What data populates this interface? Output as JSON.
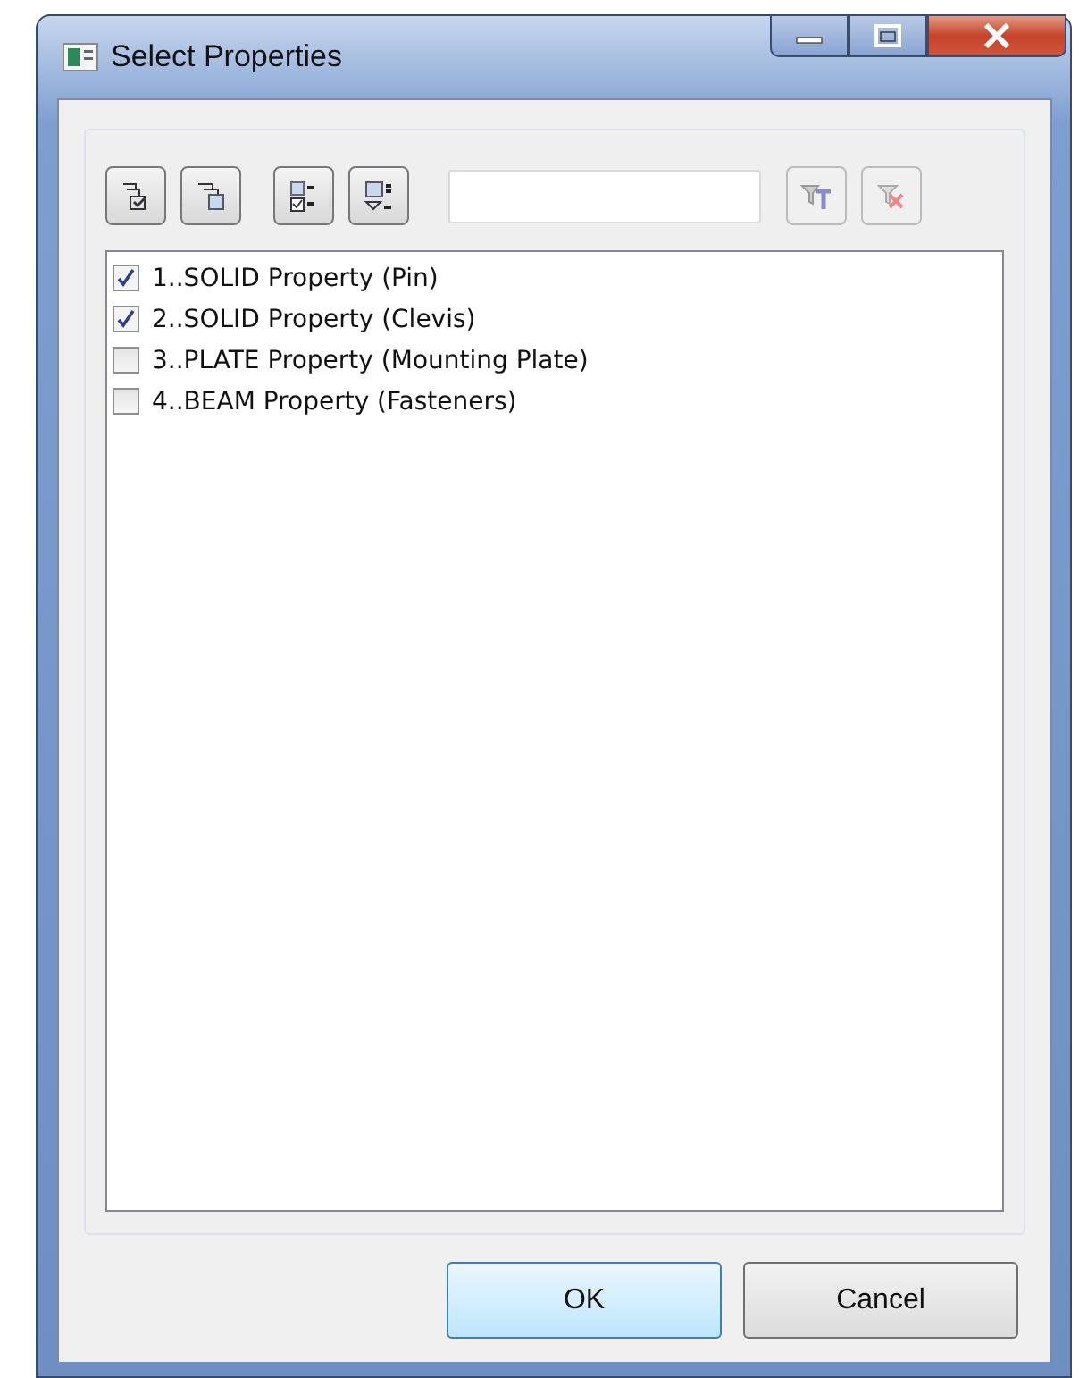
{
  "window": {
    "title": "Select Properties"
  },
  "toolbar": [
    {
      "kind": "select-all",
      "disabled": false
    },
    {
      "kind": "deselect-all",
      "disabled": false
    },
    {
      "kind": "check-list",
      "disabled": false
    },
    {
      "kind": "uncheck-list",
      "disabled": false
    },
    {
      "kind": "filter",
      "disabled": true
    },
    {
      "kind": "clear-filter",
      "disabled": true
    }
  ],
  "list": [
    {
      "label": "1..SOLID Property (Pin)",
      "checked": true
    },
    {
      "label": "2..SOLID Property (Clevis)",
      "checked": true
    },
    {
      "label": "3..PLATE Property (Mounting Plate)",
      "checked": false
    },
    {
      "label": "4..BEAM Property (Fasteners)",
      "checked": false
    }
  ],
  "buttons": [
    {
      "label": "OK",
      "default": true
    },
    {
      "label": "Cancel",
      "default": false
    }
  ]
}
